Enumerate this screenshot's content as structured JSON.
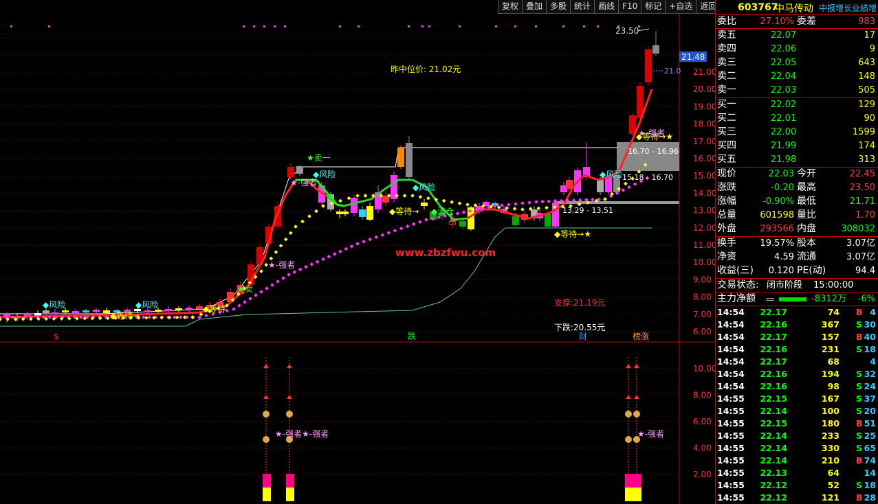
{
  "toolbar": {
    "items": [
      "复权",
      "叠加",
      "多股",
      "统计",
      "画线",
      "F10",
      "标记",
      "+自选",
      "返回"
    ]
  },
  "stock": {
    "code": "603767",
    "name": "中马传动",
    "tag": "中报增长业绩增"
  },
  "weibi": {
    "label": "委比",
    "value": "27.10%",
    "label2": "委差",
    "value2": "983"
  },
  "asks": [
    {
      "label": "卖五",
      "price": "22.07",
      "vol": "17"
    },
    {
      "label": "卖四",
      "price": "22.06",
      "vol": "9"
    },
    {
      "label": "卖三",
      "price": "22.05",
      "vol": "643"
    },
    {
      "label": "卖二",
      "price": "22.04",
      "vol": "148"
    },
    {
      "label": "卖一",
      "price": "22.03",
      "vol": "505"
    }
  ],
  "bids": [
    {
      "label": "买一",
      "price": "22.02",
      "vol": "129"
    },
    {
      "label": "买二",
      "price": "22.01",
      "vol": "90"
    },
    {
      "label": "买三",
      "price": "22.00",
      "vol": "1599"
    },
    {
      "label": "买四",
      "price": "21.99",
      "vol": "174"
    },
    {
      "label": "买五",
      "price": "21.98",
      "vol": "313"
    }
  ],
  "quote": [
    {
      "l1": "现价",
      "v1": "22.03",
      "c1": "grn",
      "l2": "今开",
      "v2": "22.45",
      "c2": "red"
    },
    {
      "l1": "涨跌",
      "v1": "-0.20",
      "c1": "grn",
      "l2": "最高",
      "v2": "23.50",
      "c2": "red"
    },
    {
      "l1": "涨幅",
      "v1": "-0.90%",
      "c1": "grn",
      "l2": "最低",
      "v2": "21.71",
      "c2": "grn"
    },
    {
      "l1": "总量",
      "v1": "601598",
      "c1": "yel",
      "l2": "量比",
      "v2": "1.70",
      "c2": "red"
    },
    {
      "l1": "外盘",
      "v1": "293566",
      "c1": "red",
      "l2": "内盘",
      "v2": "308032",
      "c2": "grn"
    }
  ],
  "fin": [
    {
      "l1": "换手",
      "v1": "19.57%",
      "l2": "股本",
      "v2": "3.07亿"
    },
    {
      "l1": "净资",
      "v1": "4.59",
      "l2": "流通",
      "v2": "3.07亿"
    },
    {
      "l1": "收益(三)",
      "v1": "0.120",
      "l2": "PE(动)",
      "v2": "94.4"
    }
  ],
  "status": {
    "label": "交易状态:",
    "value": "闭市阶段",
    "time": "15:00:00"
  },
  "mainflow": {
    "label": "主力净额",
    "value": "-8312万",
    "pct": "-6%"
  },
  "ticks": [
    {
      "time": "14:54",
      "price": "22.17",
      "pc": "grn",
      "vol": "74",
      "bs": "B",
      "bc": "red",
      "num": "4"
    },
    {
      "time": "14:54",
      "price": "22.16",
      "pc": "grn",
      "vol": "367",
      "bs": "S",
      "bc": "grn",
      "num": "30"
    },
    {
      "time": "14:54",
      "price": "22.17",
      "pc": "grn",
      "vol": "157",
      "bs": "B",
      "bc": "red",
      "num": "40"
    },
    {
      "time": "14:54",
      "price": "22.16",
      "pc": "grn",
      "vol": "231",
      "bs": "S",
      "bc": "grn",
      "num": "18"
    },
    {
      "time": "14:54",
      "price": "22.17",
      "pc": "grn",
      "vol": "68",
      "bs": "",
      "bc": "grn",
      "num": "4"
    },
    {
      "time": "14:54",
      "price": "22.16",
      "pc": "grn",
      "vol": "194",
      "bs": "S",
      "bc": "grn",
      "num": "32"
    },
    {
      "time": "14:54",
      "price": "22.16",
      "pc": "grn",
      "vol": "98",
      "bs": "S",
      "bc": "grn",
      "num": "24"
    },
    {
      "time": "14:55",
      "price": "22.15",
      "pc": "grn",
      "vol": "167",
      "bs": "S",
      "bc": "grn",
      "num": "37"
    },
    {
      "time": "14:55",
      "price": "22.14",
      "pc": "grn",
      "vol": "100",
      "bs": "S",
      "bc": "grn",
      "num": "20"
    },
    {
      "time": "14:55",
      "price": "22.15",
      "pc": "grn",
      "vol": "180",
      "bs": "B",
      "bc": "red",
      "num": "51"
    },
    {
      "time": "14:55",
      "price": "22.14",
      "pc": "grn",
      "vol": "233",
      "bs": "S",
      "bc": "grn",
      "num": "25"
    },
    {
      "time": "14:55",
      "price": "22.14",
      "pc": "grn",
      "vol": "330",
      "bs": "S",
      "bc": "grn",
      "num": "65"
    },
    {
      "time": "14:55",
      "price": "22.14",
      "pc": "grn",
      "vol": "210",
      "bs": "B",
      "bc": "red",
      "num": "74"
    },
    {
      "time": "14:55",
      "price": "22.13",
      "pc": "grn",
      "vol": "64",
      "bs": "",
      "bc": "grn",
      "num": "14"
    },
    {
      "time": "14:55",
      "price": "22.12",
      "pc": "grn",
      "vol": "52",
      "bs": "S",
      "bc": "grn",
      "num": "18"
    },
    {
      "time": "14:55",
      "price": "22.12",
      "pc": "grn",
      "vol": "121",
      "bs": "B",
      "bc": "red",
      "num": "28"
    }
  ],
  "chart": {
    "price_axis": [
      "21.00",
      "20.00",
      "19.00",
      "18.00",
      "17.00",
      "16.00",
      "15.00",
      "14.00",
      "13.00",
      "12.00",
      "11.00",
      "10.00",
      "9.00",
      "8.00",
      "7.00",
      "6.00"
    ],
    "last_price_tag": "21.48",
    "dash_label": "21.0",
    "high_label": "23.50",
    "zhongwei": "昨中位价: 21.02元",
    "zhicheng": "支撑:21.19元",
    "xiadie": "下跌:20.55元",
    "watermark": "www.zbzfwu.com",
    "range1": "16.70 - 16.96",
    "range2": "15.18 - 16.70",
    "range3": "13.29 - 13.51",
    "sig_fengxian": "风险",
    "sig_qiangzhe": "强者",
    "sig_dengdai": "等待",
    "sig_mai1": "卖一",
    "sig_mai": "卖",
    "sig_qingcang": "清仓",
    "sig_zhong": "中",
    "arrow_right": "→",
    "star": "★",
    "bottom_marks": [
      {
        "t": "$",
        "c": "#f33"
      },
      {
        "t": "跌",
        "c": "#0f0"
      },
      {
        "t": "财",
        "c": "#39f"
      },
      {
        "t": "榜涨",
        "c": "#f93"
      }
    ],
    "ind_axis": [
      "10.00",
      "8.00",
      "6.00",
      "4.00",
      "2.00"
    ]
  }
}
